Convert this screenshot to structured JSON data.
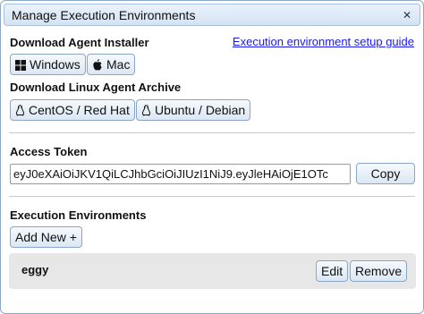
{
  "dialog": {
    "title": "Manage Execution Environments",
    "close_glyph": "✕"
  },
  "agent_installer": {
    "heading": "Download Agent Installer",
    "setup_link": "Execution environment setup guide",
    "windows_label": "Windows",
    "mac_label": "Mac"
  },
  "linux_archive": {
    "heading": "Download Linux Agent Archive",
    "centos_label": "CentOS / Red Hat",
    "ubuntu_label": "Ubuntu / Debian"
  },
  "access_token": {
    "heading": "Access Token",
    "value": "eyJ0eXAiOiJKV1QiLCJhbGciOiJIUzI1NiJ9.eyJleHAiOjE1OTc",
    "copy_label": "Copy"
  },
  "environments": {
    "heading": "Execution Environments",
    "add_label": "Add New +",
    "items": [
      {
        "name": "eggy",
        "edit_label": "Edit",
        "remove_label": "Remove"
      }
    ]
  },
  "icons": {
    "windows": "windows-icon",
    "apple": "apple-icon",
    "linux": "linux-penguin-icon",
    "close": "close-icon"
  },
  "colors": {
    "link": "#1a1aee",
    "button_border": "#8ba6c4",
    "titlebar": "#d4e3f3",
    "row_background": "#e7e7e7"
  }
}
